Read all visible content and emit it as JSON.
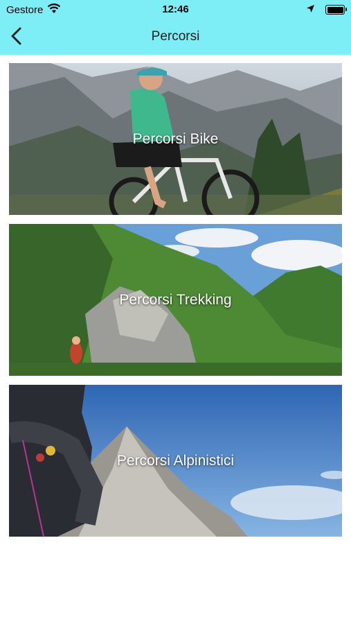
{
  "statusbar": {
    "carrier": "Gestore",
    "time": "12:46",
    "battery_level": 1.0
  },
  "navbar": {
    "title": "Percorsi",
    "back_icon": "chevron-left-icon"
  },
  "routes": [
    {
      "label": "Percorsi Bike",
      "photo": "mountain-biker-photo"
    },
    {
      "label": "Percorsi Trekking",
      "photo": "trekking-trail-photo"
    },
    {
      "label": "Percorsi Alpinistici",
      "photo": "alpine-climber-photo"
    }
  ],
  "colors": {
    "header_bg": "#7DEEF5",
    "card_text": "#FFFFFF",
    "title_text": "#222222"
  }
}
